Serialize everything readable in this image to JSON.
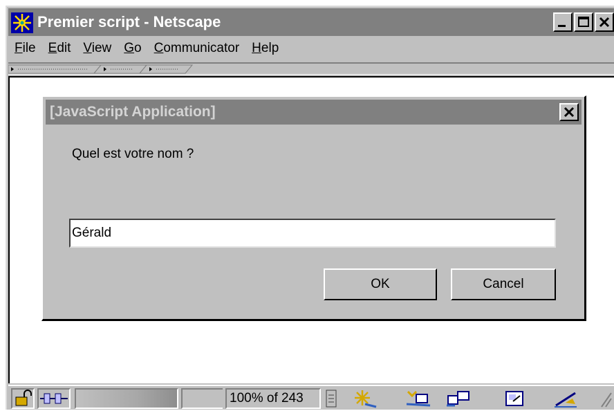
{
  "window": {
    "title": "Premier script - Netscape"
  },
  "menubar": {
    "items": [
      {
        "label": "File",
        "accel": "F",
        "rest": "ile"
      },
      {
        "label": "Edit",
        "accel": "E",
        "rest": "dit"
      },
      {
        "label": "View",
        "accel": "V",
        "rest": "iew"
      },
      {
        "label": "Go",
        "accel": "G",
        "rest": "o"
      },
      {
        "label": "Communicator",
        "accel": "C",
        "rest": "ommunicator"
      },
      {
        "label": "Help",
        "accel": "H",
        "rest": "elp"
      }
    ]
  },
  "dialog": {
    "title": "[JavaScript Application]",
    "prompt": "Quel est votre nom ?",
    "input_value": "Gérald",
    "ok_label": "OK",
    "cancel_label": "Cancel"
  },
  "statusbar": {
    "progress_text": "100% of 243",
    "progress_fraction": 1.0
  },
  "icons": {
    "app": "netscape-icon",
    "security": "lock-icon",
    "connection": "plug-icon",
    "navigator": "navigator-icon",
    "mail": "mail-icon",
    "discussion": "discussion-icon",
    "composer": "composer-icon",
    "dock": "dock-icon"
  },
  "colors": {
    "face": "#c0c0c0",
    "title_inactive": "#808080",
    "window_bg": "#ffffff"
  }
}
